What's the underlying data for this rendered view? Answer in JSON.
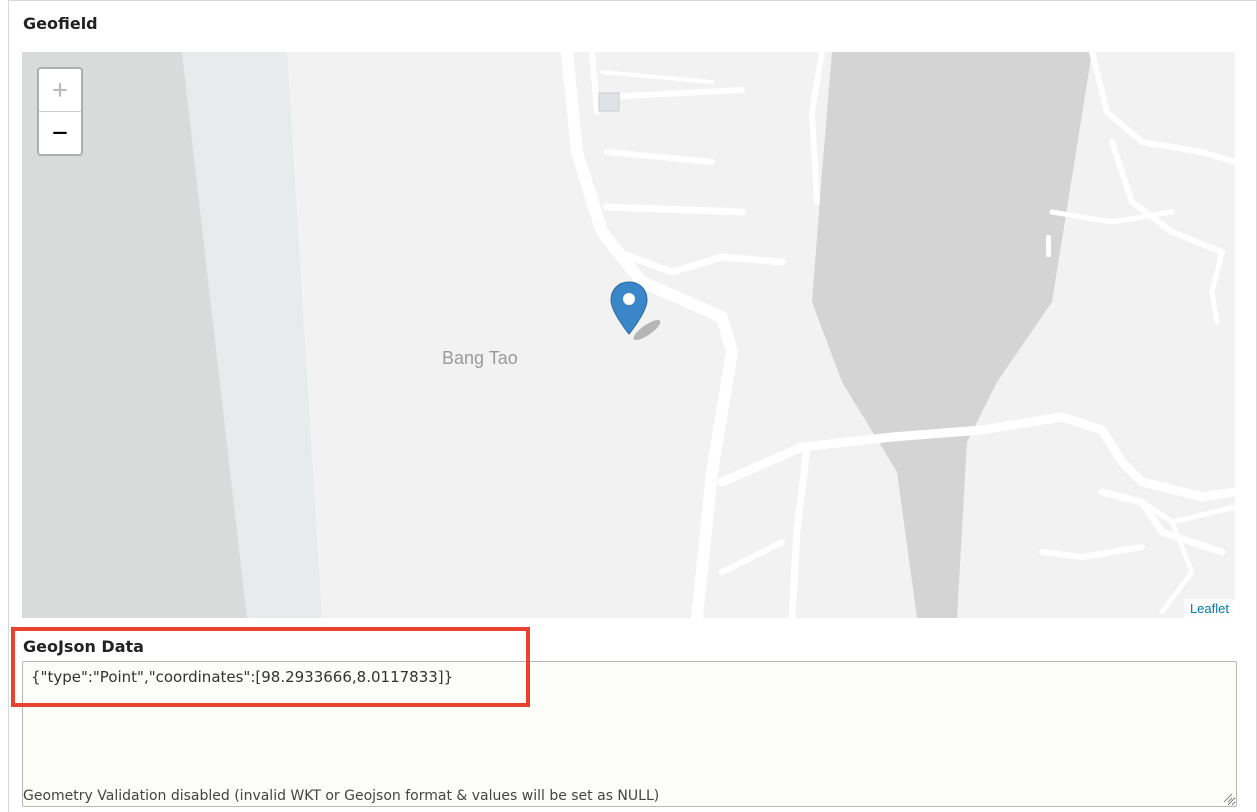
{
  "field": {
    "legend": "Geofield"
  },
  "map": {
    "zoom_in_label": "+",
    "zoom_out_label": "−",
    "place_label": "Bang Tao",
    "attribution": "Leaflet",
    "marker_icon": "map-marker-icon",
    "colors": {
      "land": "#f2f2f2",
      "water_lagoon": "#d4d4d4",
      "beach_water": "#e8ebec",
      "road": "#ffffff",
      "marker": "#3a86c8"
    }
  },
  "geojson": {
    "label": "GeoJson Data",
    "value": "{\"type\":\"Point\",\"coordinates\":[98.2933666,8.0117833]}",
    "description": "Geometry Validation disabled (invalid WKT or Geojson format & values will be set as NULL)"
  },
  "highlight_color": "#e8432e"
}
